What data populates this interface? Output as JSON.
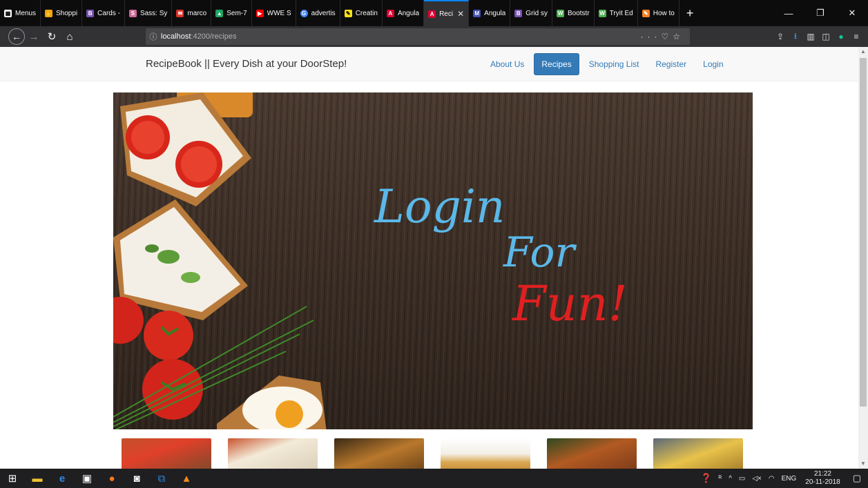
{
  "browser": {
    "tabs": [
      {
        "title": "Menus",
        "color": "#ffffff"
      },
      {
        "title": "Shoppi",
        "color": "#f0a30a"
      },
      {
        "title": "Cards -",
        "color": "#7952b3"
      },
      {
        "title": "Sass: Sy",
        "color": "#cd6799"
      },
      {
        "title": "marco",
        "color": "#d93025"
      },
      {
        "title": "Sem-7",
        "color": "#1fa463"
      },
      {
        "title": "WWE S",
        "color": "#ff0000"
      },
      {
        "title": "advertis",
        "color": "#4285f4"
      },
      {
        "title": "Creatin",
        "color": "#f7df1e"
      },
      {
        "title": "Angula",
        "color": "#dd0031"
      },
      {
        "title": "Reci",
        "color": "#dd0031",
        "active": true
      },
      {
        "title": "Angula",
        "color": "#3f51b5"
      },
      {
        "title": "Grid sy",
        "color": "#7952b3"
      },
      {
        "title": "Bootstr",
        "color": "#4caf50"
      },
      {
        "title": "Tryit Ed",
        "color": "#4caf50"
      },
      {
        "title": "How to",
        "color": "#f48024"
      }
    ],
    "url_host": "localhost",
    "url_path": ":4200/recipes"
  },
  "navbar": {
    "brand": "RecipeBook || Every Dish at your DoorStep!",
    "links": [
      {
        "label": "About Us"
      },
      {
        "label": "Recipes",
        "active": true
      },
      {
        "label": "Shopping List"
      },
      {
        "label": "Register"
      },
      {
        "label": "Login"
      }
    ]
  },
  "hero": {
    "line1": "Login",
    "line2": "For",
    "line3": "Fun!",
    "colors": {
      "blue": "#5bb8e8",
      "red": "#e02020"
    }
  },
  "taskbar": {
    "language": "ENG",
    "time": "21:22",
    "date": "20-11-2018"
  }
}
